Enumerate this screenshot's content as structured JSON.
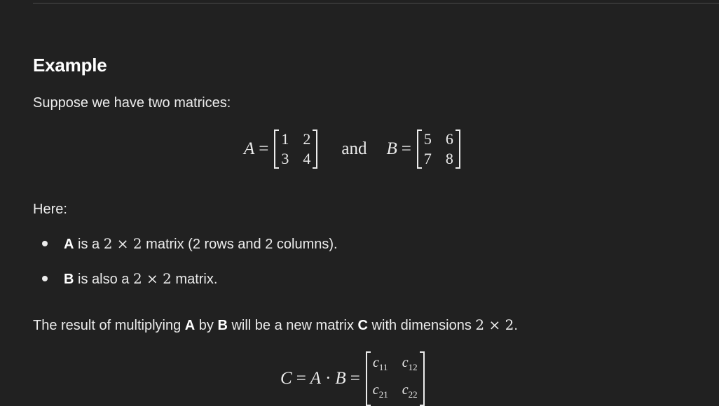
{
  "heading": "Example",
  "intro": "Suppose we have two matrices:",
  "eq1": {
    "a_var": "A",
    "eq": "=",
    "a_matrix": [
      "1",
      "2",
      "3",
      "4"
    ],
    "and": "and",
    "b_var": "B",
    "b_matrix": [
      "5",
      "6",
      "7",
      "8"
    ]
  },
  "here": "Here:",
  "bullets": [
    {
      "bold": "A",
      "pre": " is a ",
      "math": "2 × 2",
      "post": " matrix (2 rows and 2 columns)."
    },
    {
      "bold": "B",
      "pre": " is also a ",
      "math": "2 × 2",
      "post": " matrix."
    }
  ],
  "result": {
    "p1": "The result of multiplying ",
    "bold1": "A",
    "p2": " by ",
    "bold2": "B",
    "p3": " will be a new matrix ",
    "bold3": "C",
    "p4": " with dimensions ",
    "math": "2 × 2",
    "p5": "."
  },
  "eq2": {
    "c_var": "C",
    "eq1": "=",
    "a_var": "A",
    "dot": "·",
    "b_var": "B",
    "eq2": "=",
    "cells": [
      {
        "base": "c",
        "sub": "11"
      },
      {
        "base": "c",
        "sub": "12"
      },
      {
        "base": "c",
        "sub": "21"
      },
      {
        "base": "c",
        "sub": "22"
      }
    ]
  }
}
